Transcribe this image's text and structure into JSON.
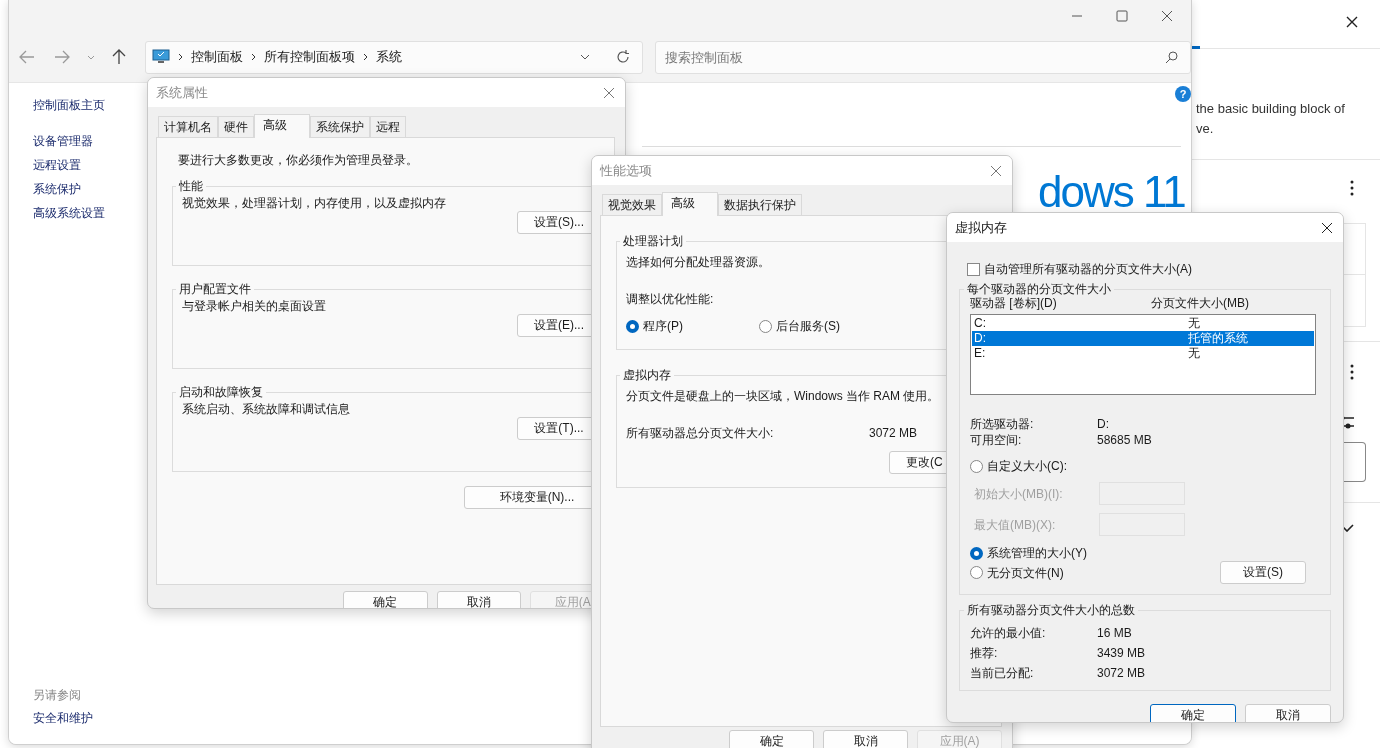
{
  "settings_panel": {
    "description": [
      "the basic building block of",
      "ve."
    ]
  },
  "explorer": {
    "breadcrumb": [
      "控制面板",
      "所有控制面板项",
      "系统"
    ],
    "search": {
      "placeholder": "搜索控制面板"
    },
    "sidebar": {
      "items": [
        "控制面板主页",
        "设备管理器",
        "远程设置",
        "系统保护",
        "高级系统设置"
      ],
      "see_also_title": "另请参阅",
      "see_also": [
        "安全和维护"
      ]
    },
    "help_glyph": "?",
    "logo_text": "dows 11"
  },
  "system_properties": {
    "title": "系统属性",
    "tabs": [
      {
        "label": "计算机名",
        "selected": false
      },
      {
        "label": "硬件",
        "selected": false
      },
      {
        "label": "高级",
        "selected": true
      },
      {
        "label": "系统保护",
        "selected": false
      },
      {
        "label": "远程",
        "selected": false
      }
    ],
    "notice": "要进行大多数更改，你必须作为管理员登录。",
    "groups": [
      {
        "title": "性能",
        "description": "视觉效果，处理器计划，内存使用，以及虚拟内存",
        "button": "设置(S)..."
      },
      {
        "title": "用户配置文件",
        "description": "与登录帐户相关的桌面设置",
        "button": "设置(E)..."
      },
      {
        "title": "启动和故障恢复",
        "description": "系统启动、系统故障和调试信息",
        "button": "设置(T)..."
      }
    ],
    "env_button": "环境变量(N)...",
    "buttons": [
      {
        "label": "确定",
        "disabled": false
      },
      {
        "label": "取消",
        "disabled": false
      },
      {
        "label": "应用(A",
        "disabled": true
      }
    ]
  },
  "performance_options": {
    "title": "性能选项",
    "tabs": [
      {
        "label": "视觉效果",
        "selected": false
      },
      {
        "label": "高级",
        "selected": true
      },
      {
        "label": "数据执行保护",
        "selected": false
      }
    ],
    "processor": {
      "title": "处理器计划",
      "description": "选择如何分配处理器资源。",
      "prompt": "调整以优化性能:",
      "options": [
        {
          "label": "程序(P)",
          "selected": true
        },
        {
          "label": "后台服务(S)",
          "selected": false
        }
      ]
    },
    "virtual_memory": {
      "title": "虚拟内存",
      "description": "分页文件是硬盘上的一块区域，Windows 当作 RAM 使用。",
      "total_label": "所有驱动器总分页文件大小:",
      "total_value": "3072 MB",
      "button": "更改(C"
    },
    "buttons": [
      {
        "label": "确定",
        "disabled": false
      },
      {
        "label": "取消",
        "disabled": false
      },
      {
        "label": "应用(A)",
        "disabled": true
      }
    ]
  },
  "virtual_memory": {
    "title": "虚拟内存",
    "auto_manage": {
      "label": "自动管理所有驱动器的分页文件大小(A)",
      "checked": false
    },
    "group_title": "每个驱动器的分页文件大小",
    "columns": [
      "驱动器 [卷标](D)",
      "分页文件大小(MB)"
    ],
    "drives": [
      {
        "drive": "C:",
        "size": "无",
        "selected": false
      },
      {
        "drive": "D:",
        "size": "托管的系统",
        "selected": true
      },
      {
        "drive": "E:",
        "size": "无",
        "selected": false
      }
    ],
    "info": [
      {
        "label": "所选驱动器:",
        "value": "D:"
      },
      {
        "label": "可用空间:",
        "value": "58685 MB"
      }
    ],
    "options": [
      {
        "label": "自定义大小(C):",
        "selected": false
      },
      {
        "label": "系统管理的大小(Y)",
        "selected": true
      },
      {
        "label": "无分页文件(N)",
        "selected": false
      }
    ],
    "fields": [
      {
        "label": "初始大小(MB)(I):",
        "disabled": true
      },
      {
        "label": "最大值(MB)(X):",
        "disabled": true
      }
    ],
    "set_button": "设置(S)",
    "totals": {
      "title": "所有驱动器分页文件大小的总数",
      "rows": [
        {
          "label": "允许的最小值:",
          "value": "16 MB"
        },
        {
          "label": "推荐:",
          "value": "3439 MB"
        },
        {
          "label": "当前已分配:",
          "value": "3072 MB"
        }
      ]
    },
    "buttons": [
      {
        "label": "确定",
        "default": true
      },
      {
        "label": "取消",
        "default": false
      }
    ]
  }
}
